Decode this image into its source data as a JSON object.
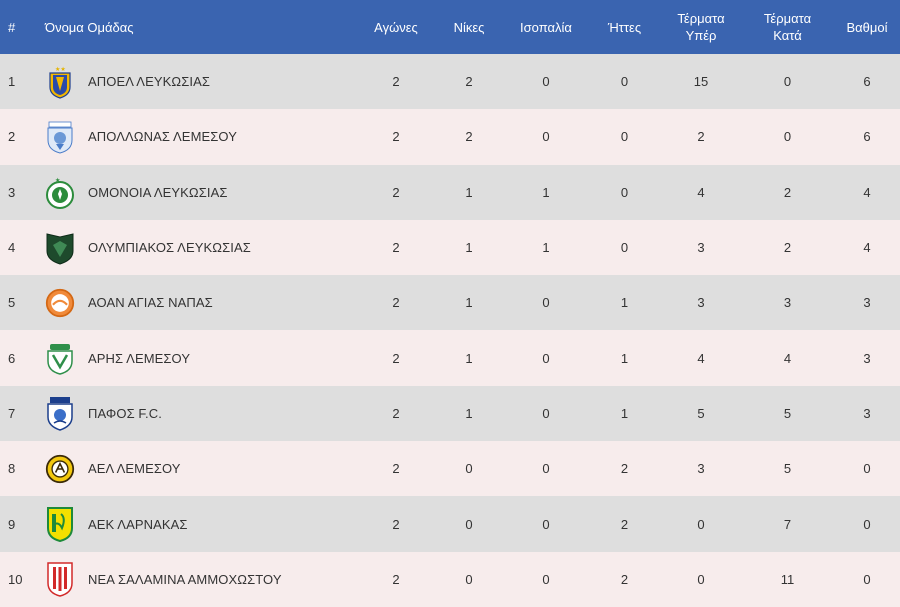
{
  "header": {
    "pos": "#",
    "team": "Όνομα Ομάδας",
    "played": "Αγώνες",
    "wins": "Νίκες",
    "draws": "Ισοπαλία",
    "losses": "Ήττες",
    "goals_for": [
      "Τέρματα",
      "Υπέρ"
    ],
    "goals_against": [
      "Τέρματα",
      "Κατά"
    ],
    "points": "Βαθμοί"
  },
  "colors": {
    "header_bg": "#3a64b0",
    "row_odd": "#dedede",
    "row_even": "#f7ecec"
  },
  "rows": [
    {
      "pos": "1",
      "team": "ΑΠΟΕΛ ΛΕΥΚΩΣΙΑΣ",
      "logo": "apoel-crest-icon",
      "played": "2",
      "wins": "2",
      "draws": "0",
      "losses": "0",
      "gf": "15",
      "ga": "0",
      "pts": "6"
    },
    {
      "pos": "2",
      "team": "ΑΠΟΛΛΩΝΑΣ ΛΕΜΕΣΟΥ",
      "logo": "apollon-crest-icon",
      "played": "2",
      "wins": "2",
      "draws": "0",
      "losses": "0",
      "gf": "2",
      "ga": "0",
      "pts": "6"
    },
    {
      "pos": "3",
      "team": "ΟΜΟΝΟΙΑ ΛΕΥΚΩΣΙΑΣ",
      "logo": "omonoia-crest-icon",
      "played": "2",
      "wins": "1",
      "draws": "1",
      "losses": "0",
      "gf": "4",
      "ga": "2",
      "pts": "4"
    },
    {
      "pos": "4",
      "team": "ΟΛΥΜΠΙΑΚΟΣ ΛΕΥΚΩΣΙΑΣ",
      "logo": "olympiakos-crest-icon",
      "played": "2",
      "wins": "1",
      "draws": "1",
      "losses": "0",
      "gf": "3",
      "ga": "2",
      "pts": "4"
    },
    {
      "pos": "5",
      "team": "ΑΟΑΝ ΑΓΙΑΣ ΝΑΠΑΣ",
      "logo": "aoan-crest-icon",
      "played": "2",
      "wins": "1",
      "draws": "0",
      "losses": "1",
      "gf": "3",
      "ga": "3",
      "pts": "3"
    },
    {
      "pos": "6",
      "team": "ΑΡΗΣ ΛΕΜΕΣΟΥ",
      "logo": "aris-crest-icon",
      "played": "2",
      "wins": "1",
      "draws": "0",
      "losses": "1",
      "gf": "4",
      "ga": "4",
      "pts": "3"
    },
    {
      "pos": "7",
      "team": "ΠΑΦΟΣ F.C.",
      "logo": "pafos-crest-icon",
      "played": "2",
      "wins": "1",
      "draws": "0",
      "losses": "1",
      "gf": "5",
      "ga": "5",
      "pts": "3"
    },
    {
      "pos": "8",
      "team": "ΑΕΛ ΛΕΜΕΣΟΥ",
      "logo": "ael-crest-icon",
      "played": "2",
      "wins": "0",
      "draws": "0",
      "losses": "2",
      "gf": "3",
      "ga": "5",
      "pts": "0"
    },
    {
      "pos": "9",
      "team": "ΑΕΚ ΛΑΡΝΑΚΑΣ",
      "logo": "aek-crest-icon",
      "played": "2",
      "wins": "0",
      "draws": "0",
      "losses": "2",
      "gf": "0",
      "ga": "7",
      "pts": "0"
    },
    {
      "pos": "10",
      "team": "ΝΕΑ ΣΑΛΑΜΙΝΑ ΑΜΜΟΧΩΣΤΟΥ",
      "logo": "nea-salamina-crest-icon",
      "played": "2",
      "wins": "0",
      "draws": "0",
      "losses": "2",
      "gf": "0",
      "ga": "11",
      "pts": "0"
    }
  ]
}
